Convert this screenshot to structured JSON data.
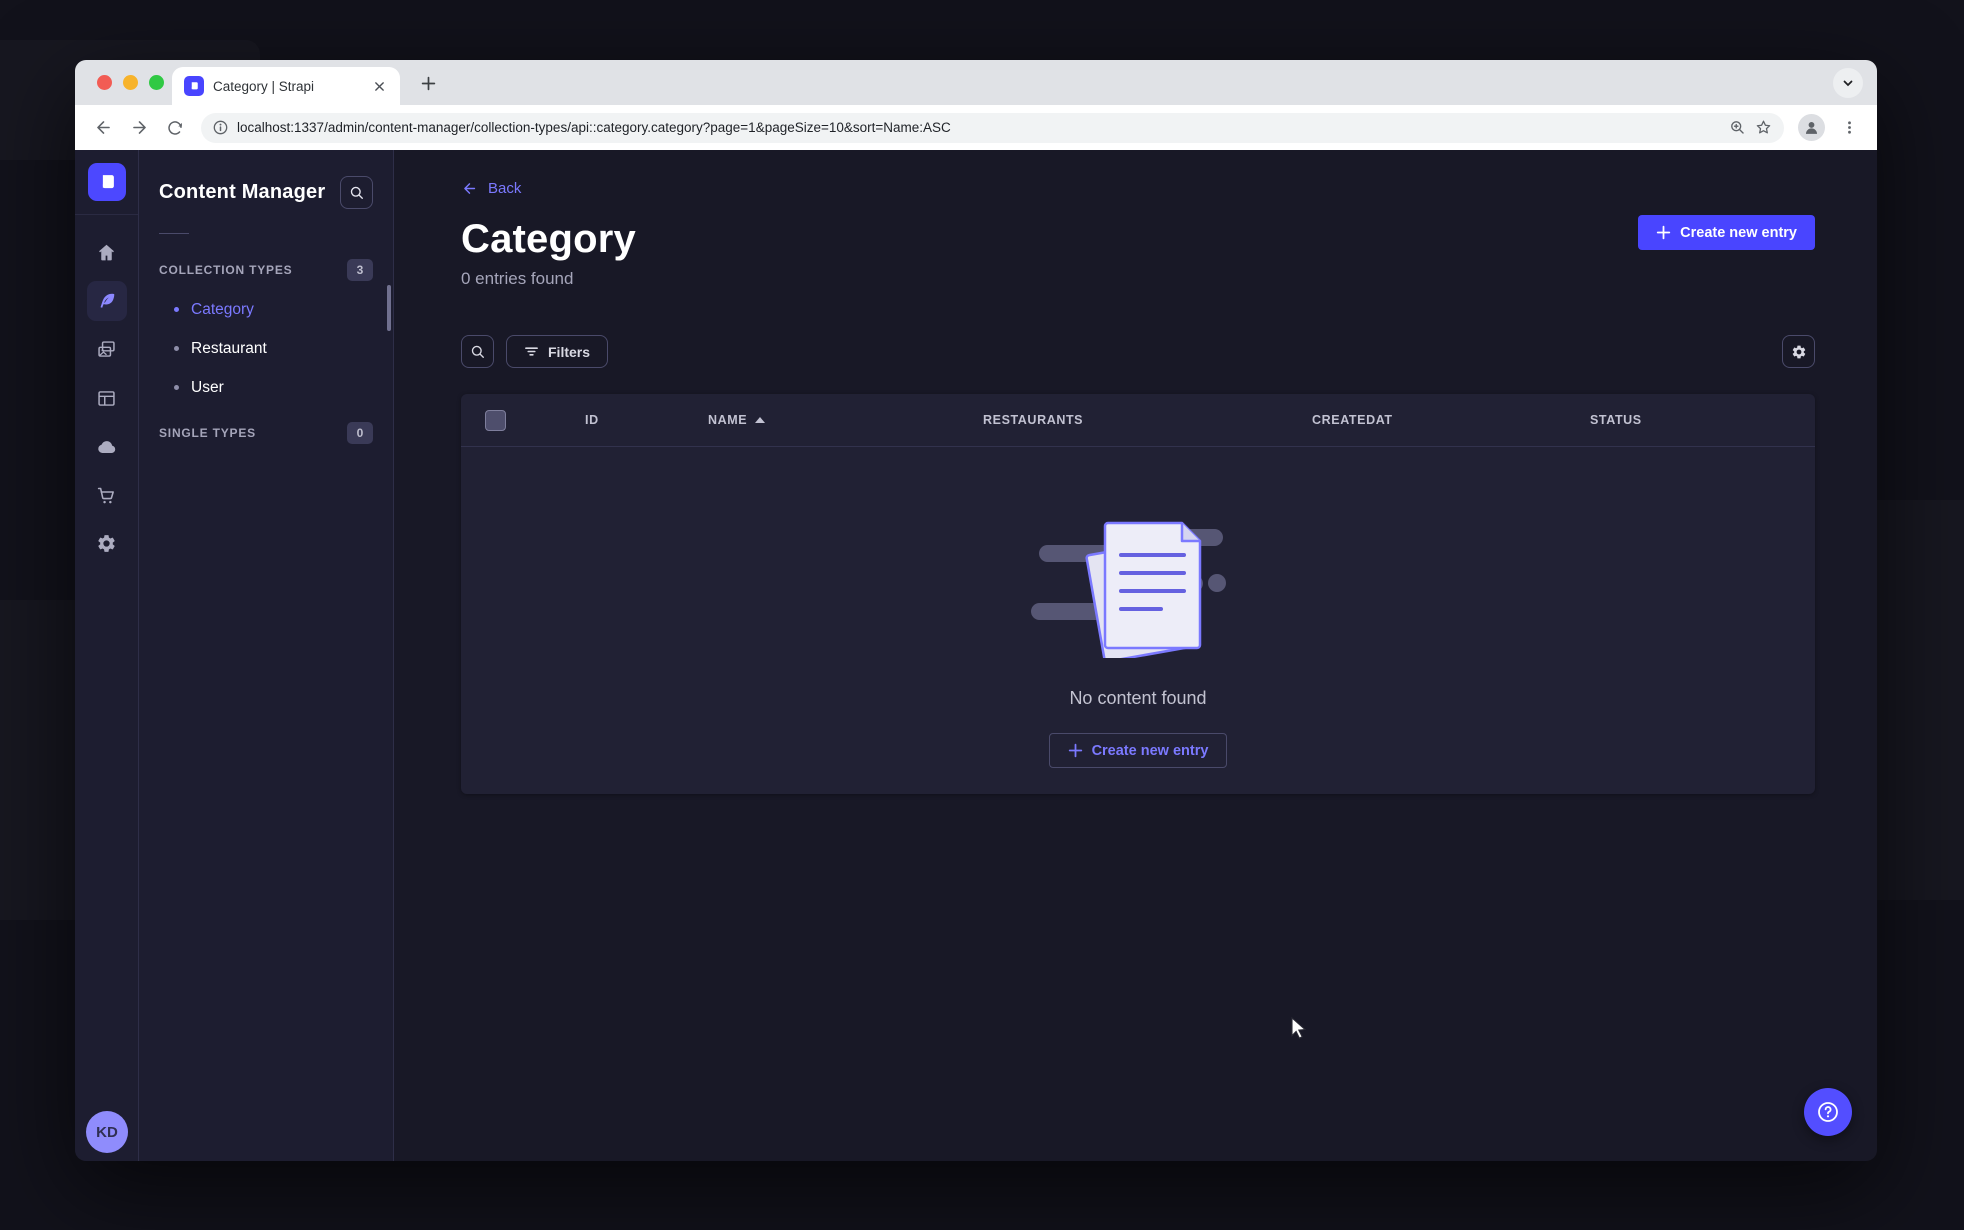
{
  "browser": {
    "tab_title": "Category | Strapi",
    "url": "localhost:1337/admin/content-manager/collection-types/api::category.category?page=1&pageSize=10&sort=Name:ASC"
  },
  "sidebar": {
    "icons": [
      "strapi-logo",
      "home",
      "content-manager",
      "media-library",
      "content-type-builder",
      "cloud",
      "marketplace",
      "settings"
    ],
    "active_icon": "content-manager",
    "avatar_initials": "KD"
  },
  "subnav": {
    "title": "Content Manager",
    "collection_types_label": "COLLECTION TYPES",
    "collection_types_count": "3",
    "items": [
      {
        "label": "Category",
        "active": true
      },
      {
        "label": "Restaurant",
        "active": false
      },
      {
        "label": "User",
        "active": false
      }
    ],
    "single_types_label": "SINGLE TYPES",
    "single_types_count": "0"
  },
  "main": {
    "back_label": "Back",
    "title": "Category",
    "subtitle": "0 entries found",
    "create_button_label": "Create new entry",
    "filters_label": "Filters",
    "table": {
      "columns": [
        "ID",
        "NAME",
        "RESTAURANTS",
        "CREATEDAT",
        "STATUS"
      ],
      "sorted_column": "NAME",
      "sort_direction": "ASC",
      "rows": []
    },
    "empty": {
      "message": "No content found",
      "create_button_label": "Create new entry"
    }
  },
  "colors": {
    "primary": "#4945ff",
    "primary_light": "#7b79ff",
    "app_background": "#181826",
    "surface": "#212134",
    "border": "#32324d",
    "muted_text": "#a5a5ba"
  }
}
